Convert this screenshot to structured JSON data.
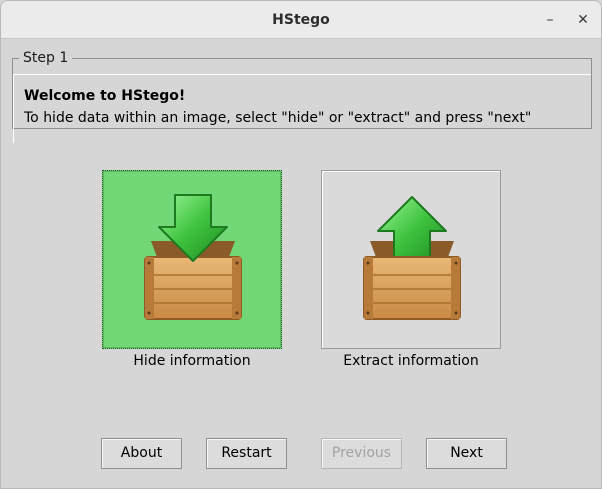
{
  "window": {
    "title": "HStego",
    "minimize_glyph": "–",
    "close_glyph": "✕"
  },
  "step": {
    "legend": "Step 1",
    "heading": "Welcome to HStego!",
    "description": "To hide data within an image, select \"hide\" or \"extract\" and press \"next\""
  },
  "options": {
    "hide": {
      "label": "Hide information",
      "selected": true,
      "icon": "box-download-icon"
    },
    "extract": {
      "label": "Extract information",
      "selected": false,
      "icon": "box-upload-icon"
    }
  },
  "buttons": {
    "about": "About",
    "restart": "Restart",
    "previous": "Previous",
    "previous_enabled": false,
    "next": "Next"
  },
  "colors": {
    "selected_bg": "#72d877",
    "arrow_green": "#3fb83f",
    "crate_wood": "#d9a05b"
  }
}
